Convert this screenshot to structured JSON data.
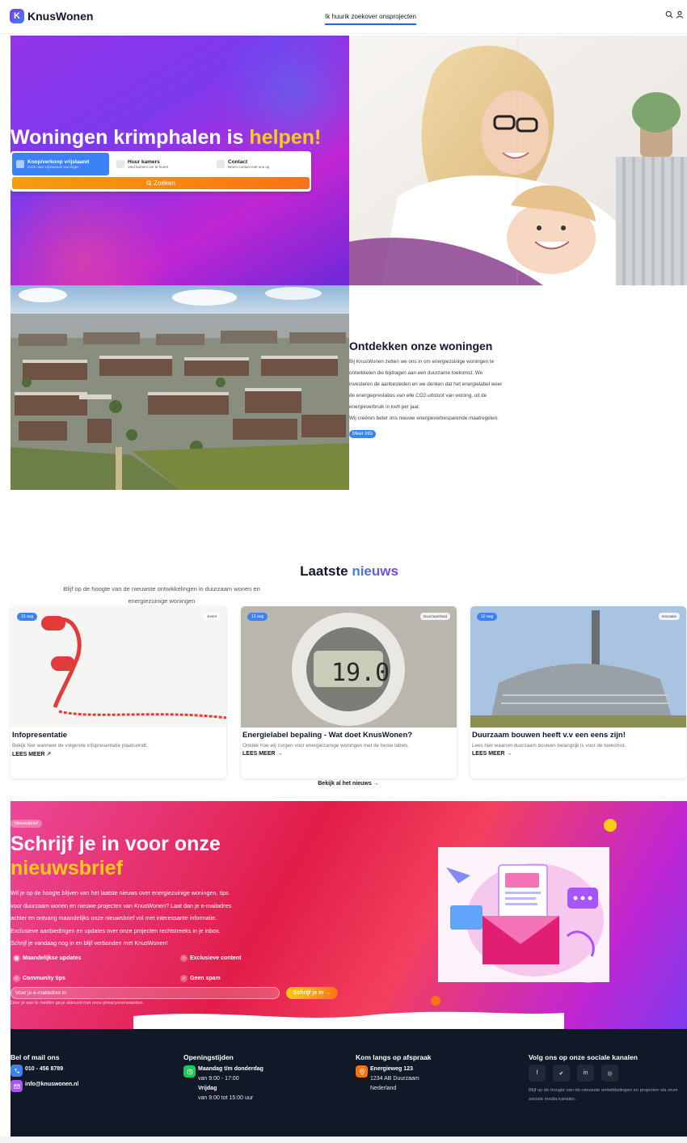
{
  "nav": {
    "brand": "KnusWonen",
    "brand_letter": "K",
    "links": [
      "Ik huurik zoekover onsprojecten"
    ],
    "icons": [
      "search-icon",
      "user-icon"
    ]
  },
  "hero": {
    "title_start": "Woningen krimphalen is ",
    "title_highlight": "helpen!",
    "tabs": [
      {
        "title": "Koop/verkoop vrijstaand",
        "sub": "Zoek naar vrijstaande woningen"
      },
      {
        "title": "Huur kamers",
        "sub": "Vind kamers om te huren"
      },
      {
        "title": "Contact",
        "sub": "Neem contact met ons op"
      }
    ],
    "search_button": "Zoeken"
  },
  "discover": {
    "title": "Ontdekken onze woningen",
    "lines": [
      "Bij KnusWonen zetten we ons in om energiezuinige woningen te",
      "ontwikkelen die bijdragen aan een duurzame toekomst. We",
      "investeren de aanbesteden en we denken dat het energielabel weer",
      "de energieprestaties van elle CO2-uitstoot van woning, uit de",
      "energieverbruik in kwh per jaar.",
      "Wij creëren beter ons nieuwe energieverbesparende maatregelen."
    ],
    "button": "Meer info"
  },
  "news": {
    "title_start": "Laatste ",
    "title_highlight": "nieuws",
    "subtitle_1": "Blijf op de hoogte van de nieuwste ontwikkelingen in duurzaam wonen en",
    "subtitle_2": "energiezuinige woningen",
    "cards": [
      {
        "date": "15 aug",
        "category": "Event",
        "title": "Infopresentatie",
        "text": "Bekijk hier wanneer de volgende infopresentatie plaatsvindt.",
        "link": "LEES MEER"
      },
      {
        "date": "12 aug",
        "category": "Duurzaamheid",
        "title": "Energielabel bepaling - Wat doet KnusWonen?",
        "text": "Ontdek hoe wij zorgen voor energiezuinige woningen met de beste labels.",
        "link": "LEES MEER"
      },
      {
        "date": "10 aug",
        "category": "Innovatie",
        "title": "Duurzaam bouwen heeft v.v een eens zijn!",
        "text": "Lees hier waarom duurzaam bouwen belangrijk is voor de toekomst.",
        "link": "LEES MEER"
      }
    ],
    "all_news": "Bekijk al het nieuws"
  },
  "newsletter": {
    "badge": "Nieuwsbrief",
    "title_1": "Schrijf je in voor onze",
    "title_2": "nieuwsbrief",
    "text_lines": [
      "Wil je op de hoogte blijven van het laatste nieuws over energiezuinige woningen, tips",
      "voor duurzaam wonen en nieuwe projecten van KnusWonen? Laat dan je e-mailadres",
      "achter en ontvang maandelijks onze nieuwsbrief vol met interessante informatie.",
      "Exclusieve aanbiedingen en updates over onze projecten rechtstreeks in je inbox.",
      "Schrijf je vandaag nog in en blijf verbonden met KnusWonen!"
    ],
    "features": [
      "Maandelijkse updates",
      "Exclusieve content",
      "Community tips",
      "Geen spam"
    ],
    "input_placeholder": "Voer je e-mailadres in",
    "button": "Schrijf je in",
    "note": "Door je aan te melden ga je akkoord met onze privacyvoorwaarden"
  },
  "footer": {
    "contact_title": "Bel of mail ons",
    "phone": "010 - 456 8789",
    "email": "info@knuswonen.nl",
    "hours_title": "Openingstijden",
    "hours_1_day": "Maandag t/m donderdag",
    "hours_1_time": "van 9:00 - 17:00",
    "hours_2_day": "Vrijdag",
    "hours_2_time": "van 9:00 tot 15:00 uur",
    "visit_title": "Kom langs op afspraak",
    "street": "Energieweg 123",
    "city": "1234 AB Duurzaam",
    "country": "Nederland",
    "social_title": "Volg ons op onze sociale kanalen",
    "social_icons": [
      "facebook-icon",
      "twitter-icon",
      "linkedin-icon",
      "instagram-icon"
    ],
    "social_note": "Blijf op de hoogte van de nieuwste ontwikkelingen en projecten via onze sociale media kanalen."
  },
  "colors": {
    "accent": "#3b82f6",
    "brand_purple": "#7c3aed",
    "highlight_yellow": "#facc15",
    "footer_bg": "#111827"
  }
}
